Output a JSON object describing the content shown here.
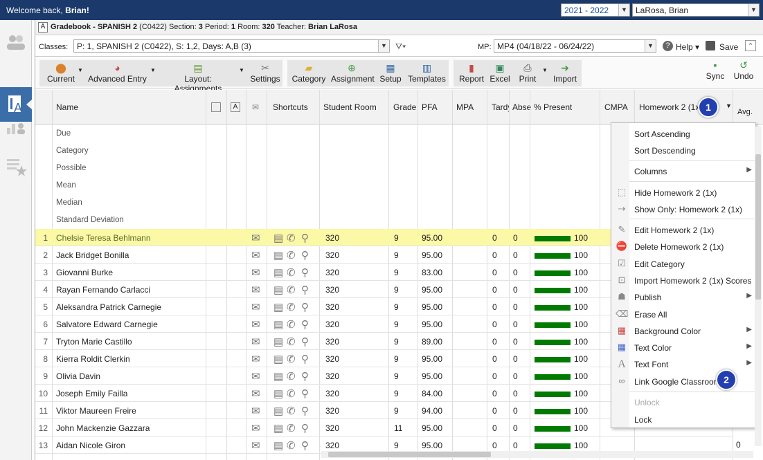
{
  "topbar": {
    "welcome_prefix": "Welcome back, ",
    "welcome_name": "Brian!",
    "year": "2021 - 2022",
    "user": "LaRosa, Brian"
  },
  "title": {
    "app": "Gradebook - SPANISH 2",
    "code": "(C0422) Section:",
    "section": "3",
    "period_label": "Period:",
    "period": "1",
    "room_label": "Room:",
    "room": "320",
    "teacher_label": "Teacher:",
    "teacher": "Brian LaRosa"
  },
  "classbar": {
    "classes_label": "Classes:",
    "classes_value": "P: 1, SPANISH 2 (C0422), S: 1,2, Days: A,B (3)",
    "mp_label": "MP:",
    "mp_value": "MP4 (04/18/22 - 06/24/22)",
    "help": "Help",
    "save": "Save"
  },
  "toolbar": {
    "current": "Current",
    "advanced": "Advanced Entry",
    "layout": "Layout: Assignments",
    "settings": "Settings",
    "category": "Category",
    "assignment": "Assignment",
    "setup": "Setup",
    "templates": "Templates",
    "report": "Report",
    "excel": "Excel",
    "print": "Print",
    "import": "Import",
    "sync": "Sync",
    "undo": "Undo"
  },
  "columns": {
    "name": "Name",
    "shortcuts": "Shortcuts",
    "room": "Student Room",
    "grade": "Grade",
    "pfa": "PFA",
    "mpa": "MPA",
    "tardy": "Tardy",
    "absent": "Abse",
    "present": "% Present",
    "cmpa": "CMPA",
    "hw": "Homework 2 (1x)",
    "avg": "Avg."
  },
  "summary": [
    "Due",
    "Category",
    "Possible",
    "Mean",
    "Median",
    "Standard Deviation"
  ],
  "students": [
    {
      "n": "1",
      "name": "Chelsie Teresa Behlmann",
      "room": "320",
      "grade": "9",
      "pfa": "95.00",
      "t": "0",
      "a": "0",
      "p": "100"
    },
    {
      "n": "2",
      "name": "Jack Bridget Bonilla",
      "room": "320",
      "grade": "9",
      "pfa": "95.00",
      "t": "0",
      "a": "0",
      "p": "100"
    },
    {
      "n": "3",
      "name": "Giovanni Burke",
      "room": "320",
      "grade": "9",
      "pfa": "83.00",
      "t": "0",
      "a": "0",
      "p": "100"
    },
    {
      "n": "4",
      "name": "Rayan Fernando Carlacci",
      "room": "320",
      "grade": "9",
      "pfa": "95.00",
      "t": "0",
      "a": "0",
      "p": "100"
    },
    {
      "n": "5",
      "name": "Aleksandra Patrick Carnegie",
      "room": "320",
      "grade": "9",
      "pfa": "95.00",
      "t": "0",
      "a": "0",
      "p": "100"
    },
    {
      "n": "6",
      "name": "Salvatore Edward Carnegie",
      "room": "320",
      "grade": "9",
      "pfa": "95.00",
      "t": "0",
      "a": "0",
      "p": "100"
    },
    {
      "n": "7",
      "name": "Tryton Marie Castillo",
      "room": "320",
      "grade": "9",
      "pfa": "89.00",
      "t": "0",
      "a": "0",
      "p": "100"
    },
    {
      "n": "8",
      "name": "Kierra Roldit Clerkin",
      "room": "320",
      "grade": "9",
      "pfa": "95.00",
      "t": "0",
      "a": "0",
      "p": "100"
    },
    {
      "n": "9",
      "name": "Olivia Davin",
      "room": "320",
      "grade": "9",
      "pfa": "95.00",
      "t": "0",
      "a": "0",
      "p": "100"
    },
    {
      "n": "10",
      "name": "Joseph Emily Failla",
      "room": "320",
      "grade": "9",
      "pfa": "84.00",
      "t": "0",
      "a": "0",
      "p": "100"
    },
    {
      "n": "11",
      "name": "Viktor Maureen Freire",
      "room": "320",
      "grade": "9",
      "pfa": "94.00",
      "t": "0",
      "a": "0",
      "p": "100"
    },
    {
      "n": "12",
      "name": "John Mackenzie Gazzara",
      "room": "320",
      "grade": "11",
      "pfa": "95.00",
      "t": "0",
      "a": "0",
      "p": "100"
    },
    {
      "n": "13",
      "name": "Aidan Nicole Giron",
      "room": "320",
      "grade": "9",
      "pfa": "95.00",
      "t": "0",
      "a": "0",
      "p": "100"
    }
  ],
  "last_avg": "0",
  "menu": {
    "sort_asc": "Sort Ascending",
    "sort_desc": "Sort Descending",
    "columns": "Columns",
    "hide": "Hide Homework 2 (1x)",
    "show_only": "Show Only: Homework 2 (1x)",
    "edit": "Edit Homework 2 (1x)",
    "delete": "Delete Homework 2 (1x)",
    "edit_cat": "Edit Category",
    "import": "Import Homework 2 (1x) Scores",
    "publish": "Publish",
    "erase": "Erase All",
    "bg": "Background Color",
    "textcolor": "Text Color",
    "font": "Text Font",
    "link": "Link Google Classroom",
    "unlock": "Unlock",
    "lock": "Lock"
  },
  "badges": {
    "one": "1",
    "two": "2"
  }
}
